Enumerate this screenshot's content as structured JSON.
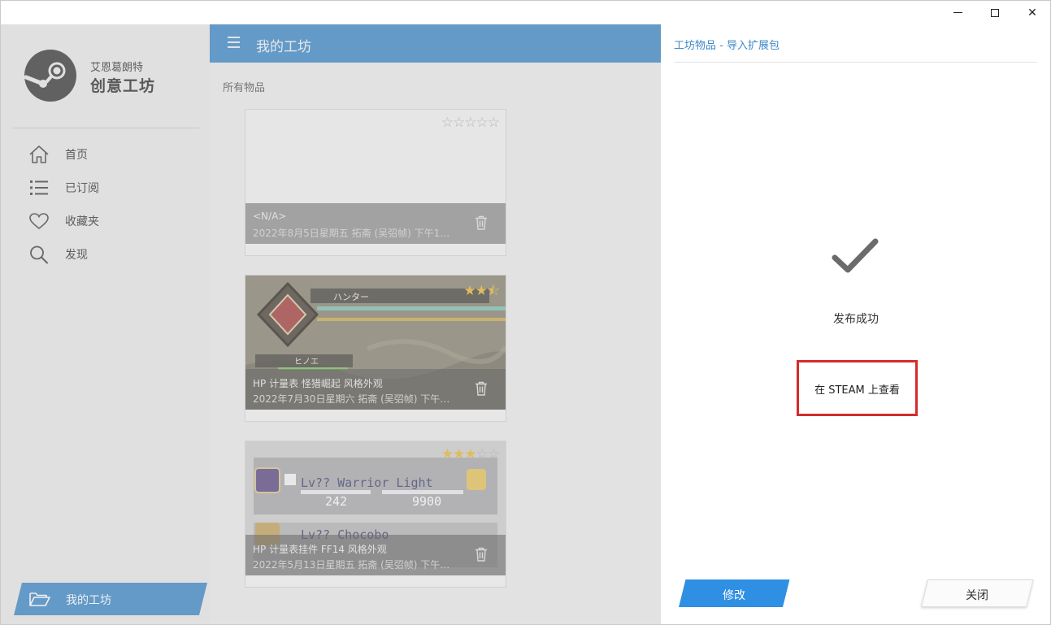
{
  "window": {
    "close_glyph": "✕"
  },
  "sidebar": {
    "app_name_line1": "艾恩葛朗特",
    "app_name_line2": "创意工坊",
    "items": [
      {
        "label": "首页",
        "icon": "home-icon"
      },
      {
        "label": "已订阅",
        "icon": "list-icon"
      },
      {
        "label": "收藏夹",
        "icon": "heart-icon"
      },
      {
        "label": "发现",
        "icon": "search-icon"
      }
    ],
    "active_item": {
      "label": "我的工坊",
      "icon": "folder-open-icon"
    }
  },
  "main": {
    "title": "我的工坊",
    "section_title": "所有物品",
    "cards": [
      {
        "name": "<N/A>",
        "date": "2022年8月5日星期五 拓斋 (吴弨帧) 下午1…",
        "stars_on": 0,
        "stars_total": 5
      },
      {
        "name": "HP 计量表 怪猎崛起 风格外观",
        "date": "2022年7月30日星期六 拓斋 (吴弨帧) 下午…",
        "stars_on": 2.5,
        "stars_total": 5
      },
      {
        "name": "HP 计量表挂件 FF14 风格外观",
        "date": "2022年5月13日星期五 拓斋 (吴弨帧) 下午…",
        "stars_on": 3,
        "stars_total": 5
      }
    ],
    "colors": {
      "header": "#3d88c6"
    }
  },
  "dialog": {
    "title": "工坊物品 - 导入扩展包",
    "status": "发布成功",
    "view_on_steam": "在 STEAM 上查看",
    "edit_button": "修改",
    "close_button": "关闭",
    "colors": {
      "accent": "#3d88c6",
      "edit_button": "#2e8fe3",
      "highlight_box": "#d62b2b"
    }
  }
}
